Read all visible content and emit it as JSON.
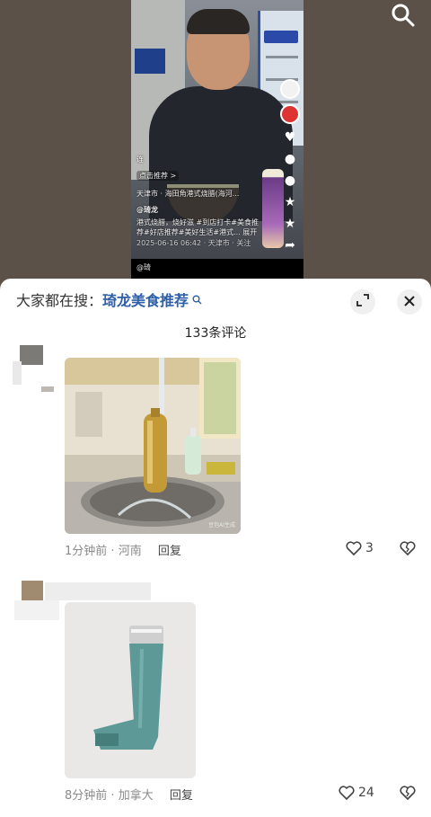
{
  "video": {
    "caption_lines": [
      "连",
      "点击推荐 >",
      "天津市 · 海田角港式烧腊(海河...",
      "@琦龙",
      "港式烧腊，烧好滋 #到店打卡#美食推",
      "荐#好店推荐#美好生活#港式... 展开",
      "2025-06-16 06:42 · 天津市 · 关注",
      "@琦"
    ]
  },
  "sheet": {
    "search_prefix": "大家都在搜：",
    "search_keyword": "琦龙美食推荐",
    "comment_count": "133条评论"
  },
  "comments": [
    {
      "time": "1分钟前",
      "location": "河南",
      "reply_label": "回复",
      "likes": "3"
    },
    {
      "time": "8分钟前",
      "location": "加拿大",
      "reply_label": "回复",
      "likes": "24"
    }
  ],
  "watermark": "豆包AI生成",
  "colors": {
    "accent": "#2e5fa8",
    "sheet_bg": "#ffffff",
    "video_bg": "#5b5149"
  },
  "icons": [
    "search-icon",
    "expand-icon",
    "close-icon",
    "heart-icon",
    "broken-heart-icon"
  ]
}
